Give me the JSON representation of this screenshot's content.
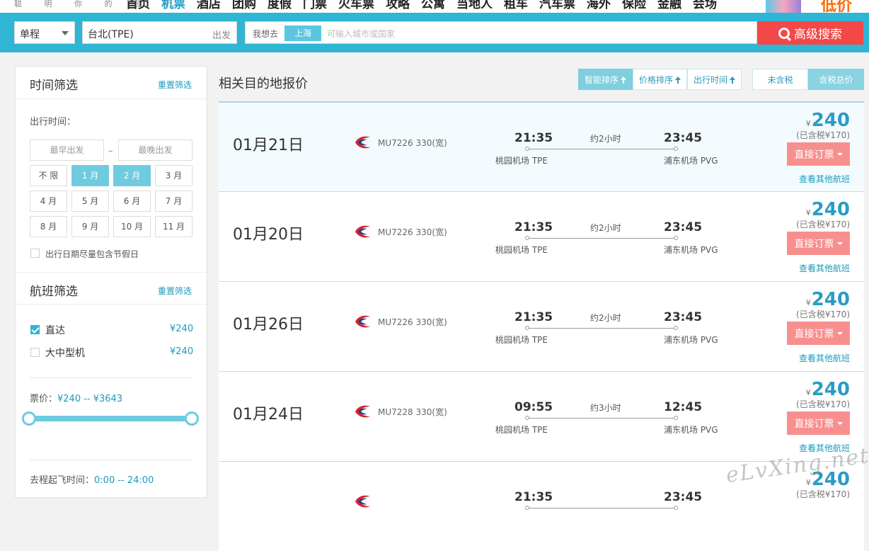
{
  "topnav": {
    "slogan": "聪 明 你 的 旅 行",
    "links": [
      "首页",
      "机票",
      "酒店",
      "团购",
      "度假",
      "门票",
      "火车票",
      "攻略",
      "公寓",
      "当地人",
      "租车",
      "汽车票",
      "海外",
      "保险",
      "金融",
      "会场"
    ],
    "active_link": "机票",
    "promo_text": "低价"
  },
  "search": {
    "trip_type": "单程",
    "from_city": "台北(TPE)",
    "from_tag": "出发",
    "dest_label": "我想去",
    "dest_chip": "上海",
    "dest_placeholder": "可输入城市或国家",
    "button_label": "高级搜索"
  },
  "sidebar": {
    "time_filter": {
      "title": "时间筛选",
      "reset": "重置筛选",
      "travel_time_label": "出行时间：",
      "earliest_placeholder": "最早出发",
      "latest_placeholder": "最晚出发",
      "dash": "–",
      "months": [
        {
          "label": "不 限",
          "selected": false
        },
        {
          "label": "1 月",
          "selected": true
        },
        {
          "label": "2 月",
          "selected": true
        },
        {
          "label": "3 月",
          "selected": false
        },
        {
          "label": "4 月",
          "selected": false
        },
        {
          "label": "5 月",
          "selected": false
        },
        {
          "label": "6 月",
          "selected": false
        },
        {
          "label": "7 月",
          "selected": false
        },
        {
          "label": "8 月",
          "selected": false
        },
        {
          "label": "9 月",
          "selected": false
        },
        {
          "label": "10 月",
          "selected": false
        },
        {
          "label": "11 月",
          "selected": false
        }
      ],
      "holiday_checkbox_label": "出行日期尽量包含节假日",
      "holiday_checked": false
    },
    "flight_filter": {
      "title": "航班筛选",
      "reset": "重置筛选",
      "options": [
        {
          "label": "直达",
          "price": "¥240",
          "checked": true
        },
        {
          "label": "大中型机",
          "price": "¥240",
          "checked": false
        }
      ],
      "price_label": "票价：",
      "price_range": "¥240 -- ¥3643",
      "departure_label": "去程起飞时间：",
      "departure_range": "0:00 -- 24:00"
    }
  },
  "main": {
    "title": "相关目的地报价",
    "sort_buttons": [
      {
        "label": "智能排序",
        "active": true
      },
      {
        "label": "价格排序",
        "active": false
      },
      {
        "label": "出行时间",
        "active": false
      }
    ],
    "tax_buttons": [
      {
        "label": "未含税",
        "active": false
      },
      {
        "label": "含税总价",
        "active": true
      }
    ],
    "results": [
      {
        "date": "01月21日",
        "flight": "MU7226 330(宽)",
        "dep_time": "21:35",
        "duration": "约2小时",
        "arr_time": "23:45",
        "dep_airport": "桃园机场 TPE",
        "arr_airport": "浦东机场 PVG",
        "currency": "¥",
        "price": "240",
        "tax_note": "(已含税¥170)",
        "book": "直接订票",
        "more": "查看其他航班"
      },
      {
        "date": "01月20日",
        "flight": "MU7226 330(宽)",
        "dep_time": "21:35",
        "duration": "约2小时",
        "arr_time": "23:45",
        "dep_airport": "桃园机场 TPE",
        "arr_airport": "浦东机场 PVG",
        "currency": "¥",
        "price": "240",
        "tax_note": "(已含税¥170)",
        "book": "直接订票",
        "more": "查看其他航班"
      },
      {
        "date": "01月26日",
        "flight": "MU7226 330(宽)",
        "dep_time": "21:35",
        "duration": "约2小时",
        "arr_time": "23:45",
        "dep_airport": "桃园机场 TPE",
        "arr_airport": "浦东机场 PVG",
        "currency": "¥",
        "price": "240",
        "tax_note": "(已含税¥170)",
        "book": "直接订票",
        "more": "查看其他航班"
      },
      {
        "date": "01月24日",
        "flight": "MU7228 330(宽)",
        "dep_time": "09:55",
        "duration": "约3小时",
        "arr_time": "12:45",
        "dep_airport": "桃园机场 TPE",
        "arr_airport": "浦东机场 PVG",
        "currency": "¥",
        "price": "240",
        "tax_note": "(已含税¥170)",
        "book": "直接订票",
        "more": "查看其他航班"
      },
      {
        "date": "",
        "flight": "",
        "dep_time": "21:35",
        "duration": "",
        "arr_time": "23:45",
        "dep_airport": "",
        "arr_airport": "",
        "currency": "¥",
        "price": "240",
        "tax_note": "(已含税¥170)",
        "book": "",
        "more": ""
      }
    ]
  },
  "watermark": "eLvXing.net",
  "colors": {
    "header_bg": "#2eb6d4",
    "accent": "#1a9bbd",
    "price": "#2a9cc4",
    "book_button": "#f88f8f",
    "search_button": "#f44747"
  }
}
